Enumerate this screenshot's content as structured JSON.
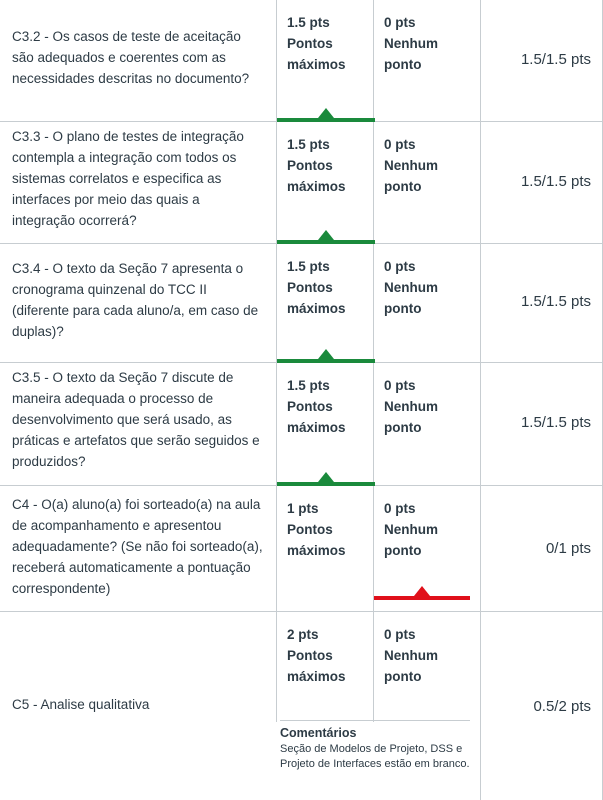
{
  "colors": {
    "selected_ok": "#1a8a3c",
    "selected_bad": "#e0101a",
    "border": "#c7cdd1",
    "text": "#2d3b45"
  },
  "rows": [
    {
      "criterion": "C3.2 - Os casos de teste de aceitação são adequados e coerentes com as necessidades descritas no documento?",
      "ratings": [
        {
          "pts": "1.5 pts",
          "label": "Pontos máximos"
        },
        {
          "pts": "0 pts",
          "label": "Nenhum ponto"
        }
      ],
      "selected_index": 0,
      "score": "1.5/1.5 pts"
    },
    {
      "criterion": "C3.3 - O plano de testes de integração contempla a integração com todos os sistemas correlatos e especifica as interfaces por meio das quais a integração ocorrerá?",
      "ratings": [
        {
          "pts": "1.5 pts",
          "label": "Pontos máximos"
        },
        {
          "pts": "0 pts",
          "label": "Nenhum ponto"
        }
      ],
      "selected_index": 0,
      "score": "1.5/1.5 pts"
    },
    {
      "criterion": "C3.4 - O texto da Seção 7 apresenta o cronograma quinzenal do TCC II (diferente para cada aluno/a, em caso de duplas)?",
      "ratings": [
        {
          "pts": "1.5 pts",
          "label": "Pontos máximos"
        },
        {
          "pts": "0 pts",
          "label": "Nenhum ponto"
        }
      ],
      "selected_index": 0,
      "score": "1.5/1.5 pts"
    },
    {
      "criterion": "C3.5 - O texto da Seção 7 discute de maneira adequada o processo de desenvolvimento que será usado, as práticas e artefatos que serão seguidos e produzidos?",
      "ratings": [
        {
          "pts": "1.5 pts",
          "label": "Pontos máximos"
        },
        {
          "pts": "0 pts",
          "label": "Nenhum ponto"
        }
      ],
      "selected_index": 0,
      "score": "1.5/1.5 pts"
    },
    {
      "criterion": "C4 - O(a) aluno(a) foi sorteado(a) na aula de acompanhamento e apresentou adequadamente? (Se não foi sorteado(a), receberá automaticamente a pontuação correspondente)",
      "ratings": [
        {
          "pts": "1 pts",
          "label": "Pontos máximos"
        },
        {
          "pts": "0 pts",
          "label": "Nenhum ponto"
        }
      ],
      "selected_index": 1,
      "score": "0/1 pts"
    },
    {
      "criterion": "C5 - Analise qualitativa",
      "ratings": [
        {
          "pts": "2 pts",
          "label": "Pontos máximos"
        },
        {
          "pts": "0 pts",
          "label": "Nenhum ponto"
        }
      ],
      "selected_index": null,
      "score": "0.5/2 pts",
      "comments_title": "Comentários",
      "comments_text": "Seção de Modelos de Projeto, DSS e Projeto de Interfaces estão em branco."
    }
  ]
}
